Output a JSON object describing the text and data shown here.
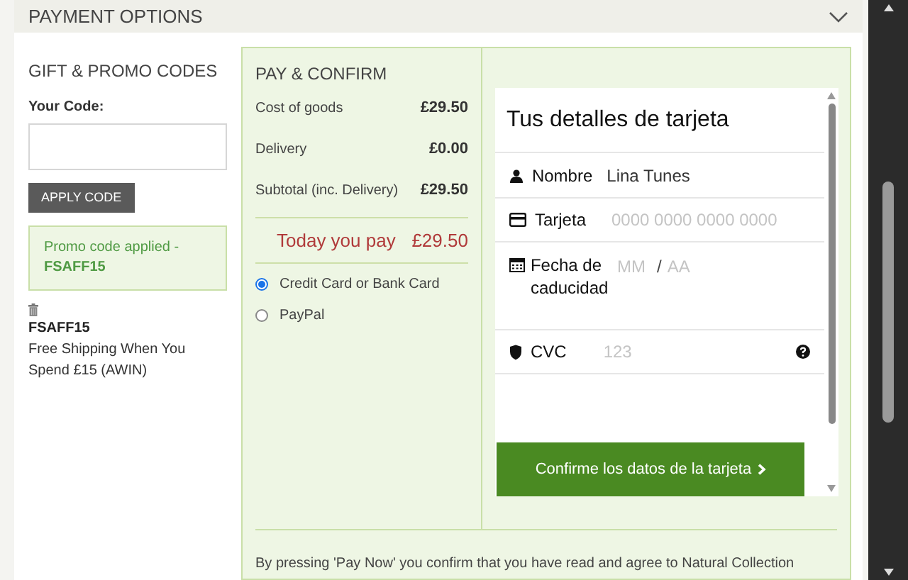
{
  "section": {
    "title": "PAYMENT OPTIONS",
    "expanded": true
  },
  "promo": {
    "title": "GIFT & PROMO CODES",
    "code_label": "Your Code:",
    "apply_button": "APPLY CODE",
    "applied_message": "Promo code applied -",
    "applied_code": "FSAFF15",
    "voucher_code": "FSAFF15",
    "voucher_description": "Free Shipping When You Spend £15 (AWIN)"
  },
  "pay": {
    "title": "PAY & CONFIRM",
    "lines": [
      {
        "label": "Cost of goods",
        "amount": "£29.50"
      },
      {
        "label": "Delivery",
        "amount": "£0.00"
      },
      {
        "label": "Subtotal (inc. Delivery)",
        "amount": "£29.50"
      }
    ],
    "total_label": "Today you pay",
    "total_amount": "£29.50",
    "methods": [
      {
        "label": "Credit Card or Bank Card",
        "selected": true
      },
      {
        "label": "PayPal",
        "selected": false
      }
    ],
    "terms": "By pressing 'Pay Now' you confirm that you have read and agree to Natural Collection"
  },
  "card_form": {
    "title": "Tus detalles de tarjeta",
    "fields": [
      {
        "kind": "name",
        "label": "Nombre",
        "value": "Lina Tunes"
      },
      {
        "kind": "card",
        "label": "Tarjeta",
        "placeholder": "0000 0000 0000 0000"
      },
      {
        "kind": "expiry",
        "label": "Fecha de caducidad",
        "month_placeholder": "MM",
        "separator": "/",
        "year_placeholder": "AA"
      },
      {
        "kind": "cvc",
        "label": "CVC",
        "placeholder": "123"
      }
    ],
    "confirm_button": "Confirme los datos de la tarjeta"
  }
}
